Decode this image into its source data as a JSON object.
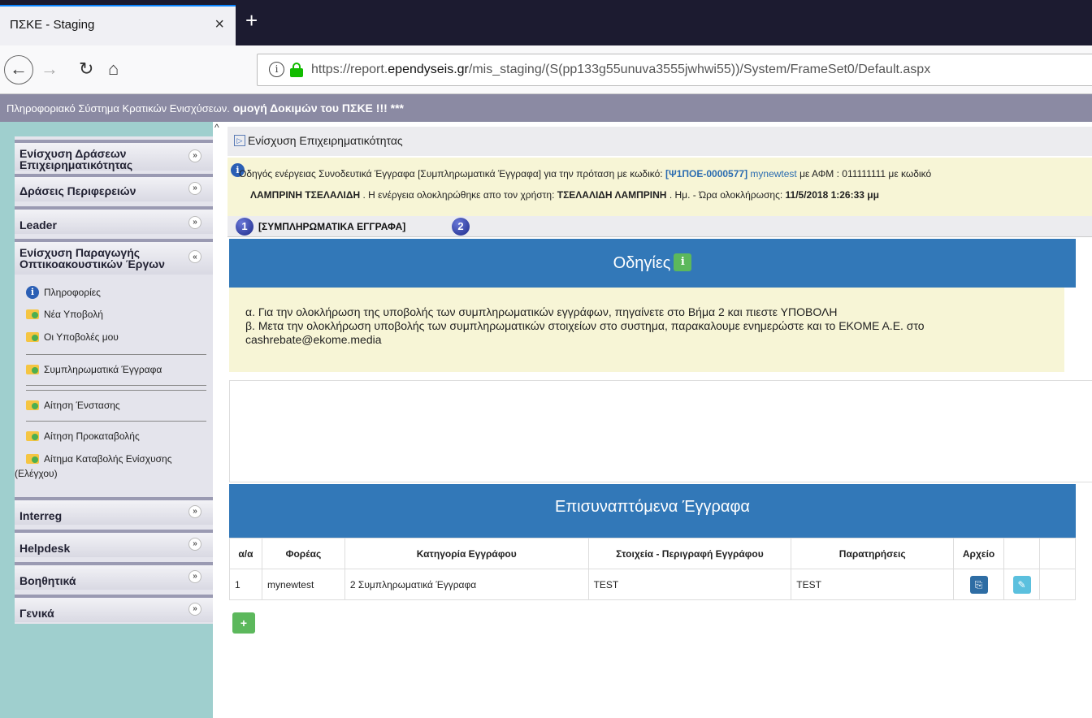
{
  "browser": {
    "tab_title": "ΠΣΚΕ - Staging",
    "tab_close": "×",
    "new_tab": "+",
    "url_prefix": "https://report.",
    "url_domain": "ependyseis.gr",
    "url_path": "/mis_staging/(S(pp133g55unuva3555jwhwi55))/System/FrameSet0/Default.aspx"
  },
  "app_header": {
    "text": "Πληροφοριακό Σύστημα Κρατικών Ενισχύσεων.",
    "bold": " ομογή Δοκιμών του ΠΣΚΕ !!! ***"
  },
  "sidebar": {
    "menus": [
      {
        "label": "Ενίσχυση Δράσεων Επιχειρηματικότητας"
      },
      {
        "label": "Δράσεις Περιφερειών"
      },
      {
        "label": "Leader"
      },
      {
        "label": "Ενίσχυση Παραγωγής Οπτικοακουστικών Έργων"
      },
      {
        "label": "Interreg"
      },
      {
        "label": "Helpdesk"
      },
      {
        "label": "Βοηθητικά"
      },
      {
        "label": "Γενικά"
      }
    ],
    "sub_items": [
      "Πληροφορίες",
      "Νέα Υποβολή",
      "Οι Υποβολές μου",
      "Συμπληρωματικά Έγγραφα",
      "Αίτηση Ένστασης",
      "Αίτηση Προκαταβολής",
      "Αίτημα Καταβολής Ενίσχυσης",
      "(Ελέγχου)"
    ]
  },
  "breadcrumb": "Ενίσχυση Επιχειρηματικότητας",
  "guide": {
    "prefix": "Οδηγός ενέργειας Συνοδευτικά Έγγραφα [Συμπληρωματικά Έγγραφα] για την πρόταση με κωδικό: ",
    "code": "[Ψ1ΠΟΕ-0000577]",
    "user": " mynewtest",
    "afm_text": " με ΑΦΜ : 011111111 με κωδικό",
    "name": "ΛΑΜΠΡΙΝΗ ΤΣΕΛΑΛΙΔΗ",
    "mid": " . Η ενέργεια ολοκληρώθηκε απο τον χρήστη: ",
    "done_by": "ΤΣΕΛΑΛΙΔΗ ΛΑΜΠΡΙΝΗ",
    "time_label": " . Ημ. - Ώρα ολοκλήρωσης: ",
    "time": "11/5/2018 1:26:33 μμ"
  },
  "steps": {
    "step1": "1",
    "step1_label": "[ΣΥΜΠΛΗΡΩΜΑΤΙΚΑ ΕΓΓΡΑΦΑ]",
    "step2": "2"
  },
  "instructions": {
    "title": "Οδηγίες",
    "line1": "α. Για την ολοκλήρωση της υποβολής των συμπληρωματικών εγγράφων, πηγαίνετε στο Βήμα 2 και πιεστε ΥΠΟΒΟΛΗ",
    "line2": "β. Μετα την ολοκλήρωση υποβολής των συμπληρωματικών στοιχείων στο συστημα, παρακαλουμε ενημερώστε και το ΕΚΟΜΕ Α.Ε. στο",
    "line3": "cashrebate@ekome.media"
  },
  "attachments": {
    "title": "Επισυναπτόμενα Έγγραφα",
    "columns": [
      "α/α",
      "Φορέας",
      "Κατηγορία Εγγράφου",
      "Στοιχεία - Περιγραφή Εγγράφου",
      "Παρατηρήσεις",
      "Αρχείο",
      ""
    ],
    "rows": [
      {
        "num": "1",
        "foreas": "mynewtest",
        "category": "2 Συμπληρωματικά Έγγραφα",
        "description": "TEST",
        "notes": "TEST"
      }
    ]
  }
}
